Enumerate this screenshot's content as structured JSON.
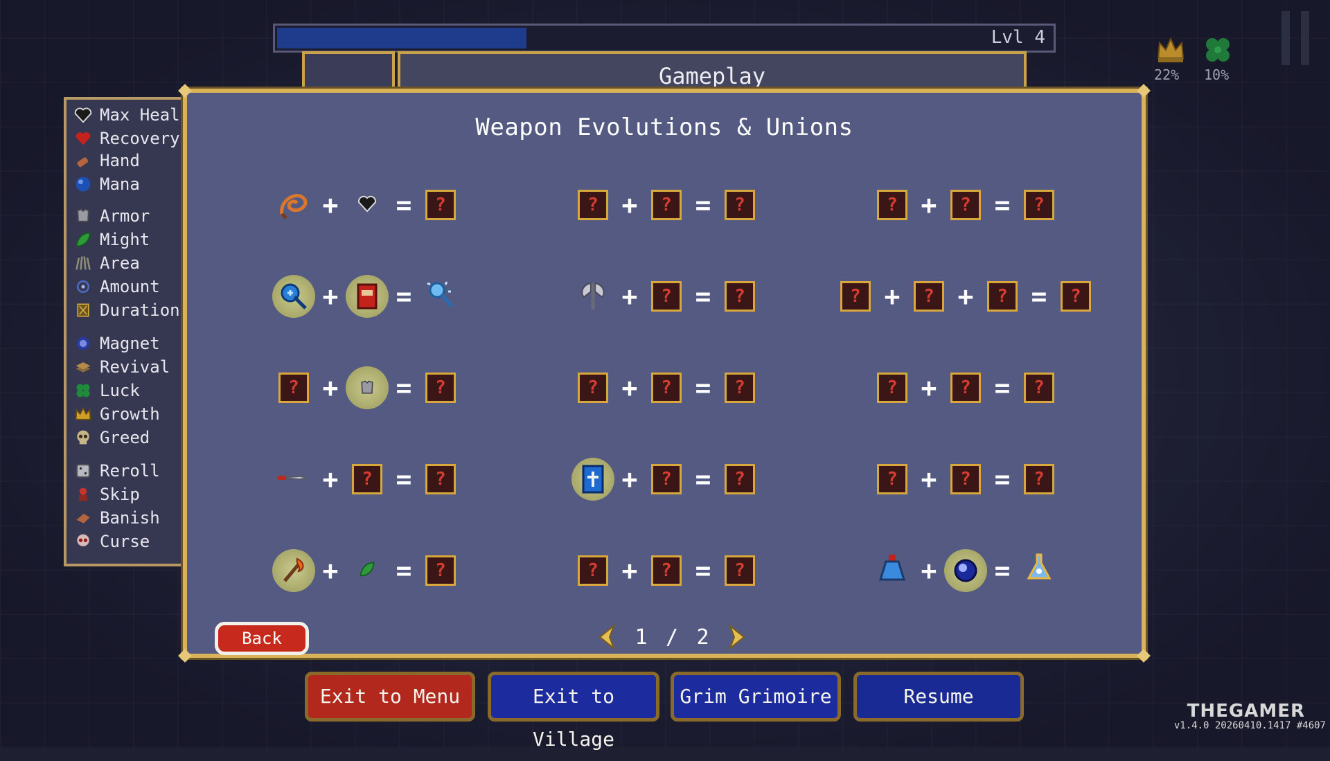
{
  "hud": {
    "level_label": "Lvl 4",
    "xp_progress": 0.32,
    "crown_percent": "22%",
    "clover_percent": "10%"
  },
  "tab": {
    "title": "Gameplay"
  },
  "stats": [
    {
      "label": "Max Healt",
      "icon": "heart-icon"
    },
    {
      "label": "Recovery",
      "icon": "recovery-heart-icon"
    },
    {
      "label": "Hand",
      "icon": "hand-icon"
    },
    {
      "label": "Mana",
      "icon": "mana-orb-icon"
    },
    {
      "label": "Armor",
      "icon": "armor-icon"
    },
    {
      "label": "Might",
      "icon": "leaf-icon"
    },
    {
      "label": "Area",
      "icon": "area-icon"
    },
    {
      "label": "Amount",
      "icon": "amount-icon"
    },
    {
      "label": "Duration",
      "icon": "duration-icon"
    },
    {
      "label": "Magnet",
      "icon": "magnet-icon"
    },
    {
      "label": "Revival",
      "icon": "revival-icon"
    },
    {
      "label": "Luck",
      "icon": "clover-icon"
    },
    {
      "label": "Growth",
      "icon": "crown-icon"
    },
    {
      "label": "Greed",
      "icon": "skull-icon"
    },
    {
      "label": "Reroll",
      "icon": "dice-icon"
    },
    {
      "label": "Skip",
      "icon": "skip-icon"
    },
    {
      "label": "Banish",
      "icon": "banish-icon"
    },
    {
      "label": "Curse",
      "icon": "curse-skull-icon"
    }
  ],
  "panel": {
    "title": "Weapon Evolutions & Unions",
    "unknown_symbol": "?",
    "plus": "+",
    "equals": "=",
    "recipes": [
      [
        "whip-icon",
        "heart-icon",
        "?"
      ],
      [
        "?",
        "?",
        "?"
      ],
      [
        "?",
        "?",
        "?"
      ],
      [
        "magic-wand-icon",
        "tome-icon",
        "holy-wand-icon"
      ],
      [
        "axe-icon",
        "?",
        "?"
      ],
      [
        "?",
        "?",
        "?",
        "?"
      ],
      [
        "?",
        "armor-icon",
        "?"
      ],
      [
        "?",
        "?",
        "?"
      ],
      [
        "?",
        "?",
        "?"
      ],
      [
        "knife-icon",
        "?",
        "?"
      ],
      [
        "king-bible-icon",
        "?",
        "?"
      ],
      [
        "?",
        "?",
        "?"
      ],
      [
        "fire-wand-icon",
        "leaf-icon",
        "?"
      ],
      [
        "?",
        "?",
        "?"
      ],
      [
        "potion-icon",
        "magnet-orb-icon",
        "evolved-potion-icon"
      ]
    ],
    "back_label": "Back",
    "page_current": "1",
    "page_separator": "/",
    "page_total": "2"
  },
  "buttons": {
    "exit_menu": "Exit to Menu",
    "exit_village": "Exit to Village",
    "grimoire": "Grim Grimoire",
    "resume": "Resume"
  },
  "watermark": "THEGAMER",
  "version": "v1.4.0 20260410.1417 #4607",
  "colors": {
    "panel_bg": "#545a82",
    "panel_border": "#d8b35a",
    "unknown_slot_text": "#d63c2f",
    "button_red": "#b3281c",
    "button_blue": "#1c2c9e"
  }
}
